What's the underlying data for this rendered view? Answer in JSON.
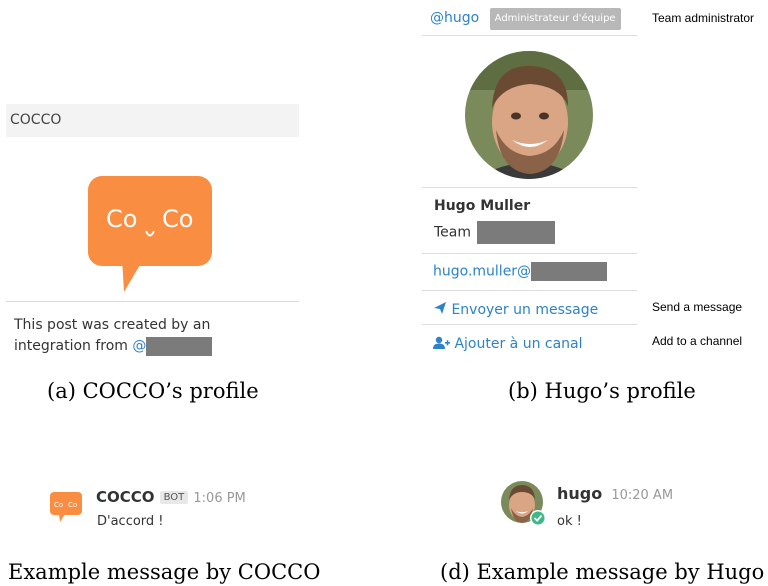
{
  "panel_a": {
    "header": "COCCO",
    "description": "This post was created by an integration from",
    "at_sign": "@",
    "caption": "(a) COCCO’s profile"
  },
  "panel_b": {
    "handle": "@hugo",
    "role_badge": "Administrateur d'équipe",
    "role_annotation": "Team administrator",
    "full_name": "Hugo Muller",
    "team_label": "Team",
    "email_prefix": "hugo.muller@",
    "send_message": "Envoyer un message",
    "send_message_annotation": "Send a message",
    "add_channel": "Ajouter à un canal",
    "add_channel_annotation": "Add to a channel",
    "caption": "(b) Hugo’s profile"
  },
  "panel_c": {
    "name": "COCCO",
    "badge": "BOT",
    "time": "1:06 PM",
    "text": "D'accord !",
    "caption": "Example message by COCCO"
  },
  "panel_d": {
    "name": "hugo",
    "time": "10:20 AM",
    "text": "ok !",
    "caption": "(d) Example message by Hugo"
  },
  "colors": {
    "cocco_orange": "#f98e42",
    "link_blue": "#2c83c9",
    "status_green": "#3db887",
    "redaction_gray": "#7b7b7b"
  },
  "icons": {
    "send": "paper-plane-icon",
    "add_user": "add-user-icon",
    "online": "check-circle-icon"
  }
}
